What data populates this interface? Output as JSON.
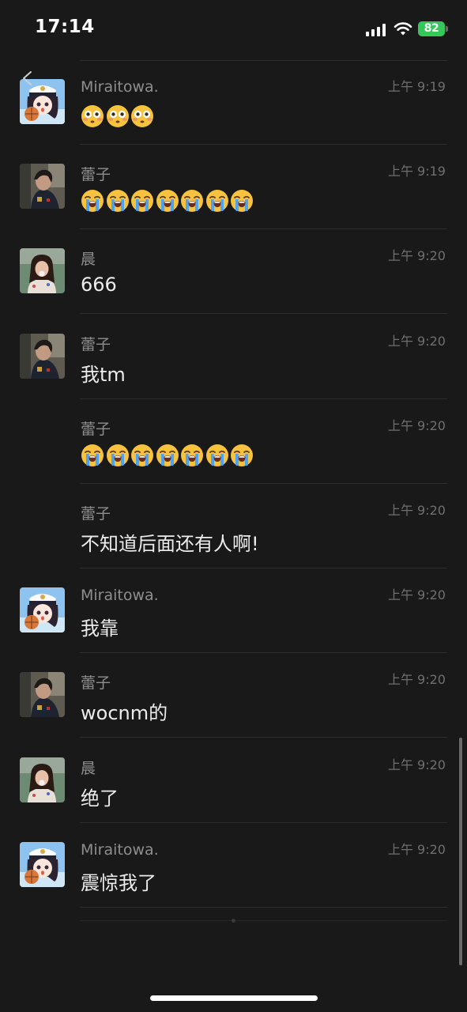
{
  "status_bar": {
    "time": "17:14",
    "battery": "82",
    "icons": [
      "signal-icon",
      "wifi-icon",
      "battery-icon"
    ]
  },
  "colors": {
    "background": "#191919",
    "sender": "#8e8e8e",
    "time": "#6f6f6f",
    "battery": "#34c759"
  },
  "messages": [
    {
      "sender": "Miraitowa.",
      "time": "上午 9:19",
      "type": "emoji",
      "emoji": "flushed",
      "count": 3,
      "avatar": "anime"
    },
    {
      "sender": "蕾子",
      "time": "上午 9:19",
      "type": "emoji",
      "emoji": "loudly-crying",
      "count": 7,
      "avatar": "photo-dark"
    },
    {
      "sender": "晨",
      "time": "上午 9:20",
      "type": "text",
      "text": "666",
      "avatar": "photo-girl"
    },
    {
      "sender": "蕾子",
      "time": "上午 9:20",
      "type": "text",
      "text": "我tm",
      "avatar": "photo-dark"
    },
    {
      "sender": "蕾子",
      "time": "上午 9:20",
      "type": "emoji",
      "emoji": "loudly-crying",
      "count": 7,
      "avatar": "none"
    },
    {
      "sender": "蕾子",
      "time": "上午 9:20",
      "type": "text",
      "text": "不知道后面还有人啊!",
      "avatar": "none"
    },
    {
      "sender": "Miraitowa.",
      "time": "上午 9:20",
      "type": "text",
      "text": "我靠",
      "avatar": "anime"
    },
    {
      "sender": "蕾子",
      "time": "上午 9:20",
      "type": "text",
      "text": "wocnm的",
      "avatar": "photo-dark"
    },
    {
      "sender": "晨",
      "time": "上午 9:20",
      "type": "text",
      "text": "绝了",
      "avatar": "photo-girl"
    },
    {
      "sender": "Miraitowa.",
      "time": "上午 9:20",
      "type": "text",
      "text": "震惊我了",
      "avatar": "anime"
    }
  ]
}
